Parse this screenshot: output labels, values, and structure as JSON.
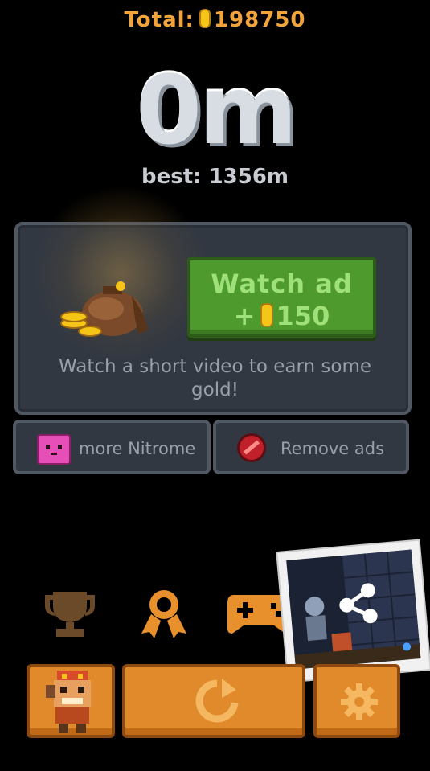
{
  "total": {
    "label": "Total:",
    "value": "198750"
  },
  "distance": {
    "value": "0m"
  },
  "best": {
    "label": "best: 1356m"
  },
  "ad_panel": {
    "watch_button": {
      "title": "Watch ad",
      "plus": "+",
      "amount": "150"
    },
    "description": "Watch a short video to earn some gold!"
  },
  "secondary_buttons": {
    "more_nitrome": "more Nitrome",
    "remove_ads": "Remove ads"
  },
  "icons": [
    "trophy-icon",
    "ribbon-icon",
    "gamepad-icon",
    "share-icon",
    "character-icon",
    "restart-icon",
    "gear-icon"
  ],
  "colors": {
    "accent": "#f2a33a",
    "button_orange": "#e08a2c",
    "ad_green": "#4f9a2c",
    "panel": "#323842"
  }
}
